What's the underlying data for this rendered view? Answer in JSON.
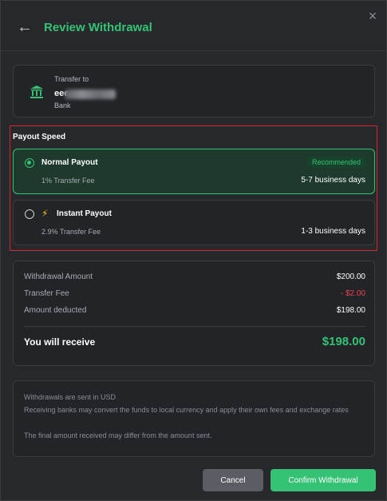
{
  "header": {
    "title": "Review Withdrawal",
    "close_icon": "×",
    "back_icon": "←"
  },
  "transfer": {
    "label": "Transfer to",
    "name_visible": "eee",
    "type": "Bank",
    "icon": "bank-icon"
  },
  "payout": {
    "section_label": "Payout Speed",
    "options": [
      {
        "name": "Normal Payout",
        "fee": "1% Transfer Fee",
        "days": "5-7 business days",
        "badge": "Recommended",
        "selected": true
      },
      {
        "name": "Instant Payout",
        "fee": "2.9% Transfer Fee",
        "days": "1-3 business days",
        "icon": "lightning-icon",
        "selected": false
      }
    ]
  },
  "summary": {
    "rows": [
      {
        "label": "Withdrawal Amount",
        "value": "$200.00"
      },
      {
        "label": "Transfer Fee",
        "value": "- $2.00"
      },
      {
        "label": "Amount deducted",
        "value": "$198.00"
      }
    ],
    "receive_label": "You will receive",
    "receive_value": "$198.00"
  },
  "notes": [
    "Withdrawals are sent in USD",
    "Receiving banks may convert the funds to local currency and apply their own fees and exchange rates",
    "The final amount received may differ from the amount sent."
  ],
  "buttons": {
    "cancel": "Cancel",
    "confirm": "Confirm Withdrawal"
  },
  "colors": {
    "accent": "#36c275",
    "negative": "#e8434b",
    "highlight_border": "#d22a2a"
  }
}
